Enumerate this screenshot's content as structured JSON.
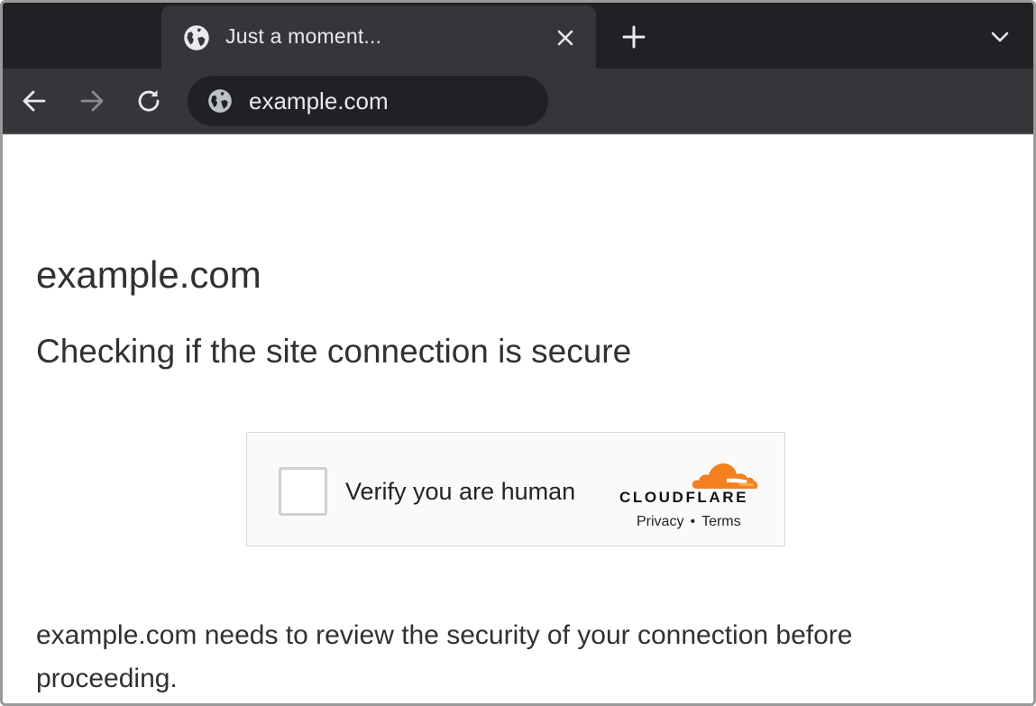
{
  "browser": {
    "tab": {
      "title": "Just a moment...",
      "favicon": "globe-icon"
    },
    "toolbar": {
      "back_icon": "arrow-left-icon",
      "forward_icon": "arrow-right-icon",
      "reload_icon": "reload-icon",
      "url": "example.com",
      "site_icon": "globe-icon"
    },
    "colors": {
      "tab_strip": "#202124",
      "toolbar": "#35363a",
      "omnibox": "#202124",
      "text_light": "#e8eaed"
    }
  },
  "page": {
    "site_title": "example.com",
    "subtitle": "Checking if the site connection is secure",
    "challenge": {
      "label": "Verify you are human",
      "brand": "CLOUDFLARE",
      "privacy_link": "Privacy",
      "separator": "•",
      "terms_link": "Terms",
      "brand_color": "#f38020"
    },
    "body_text": "example.com needs to review the security of your connection before proceeding."
  }
}
